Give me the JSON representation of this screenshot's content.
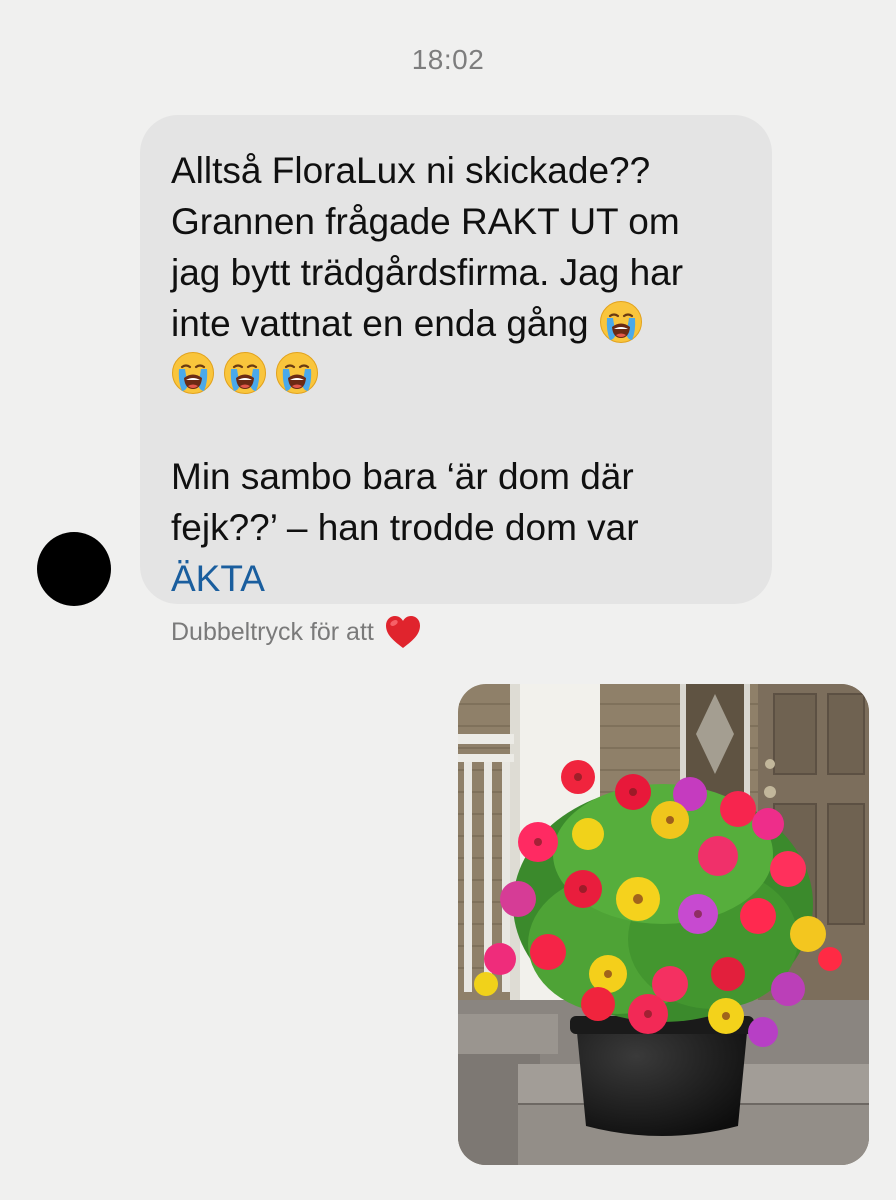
{
  "timestamp": "18:02",
  "message": {
    "lines": [
      "Alltså FloraLux ni skickade??",
      "Grannen frågade RAKT UT om",
      "jag bytt trädgårdsfirma. Jag har",
      "inte vattnat en enda gång"
    ],
    "para2_lines": [
      "Min sambo bara ‘är dom där",
      "fejk??’ – han trodde dom var"
    ],
    "link_text": "ÄKTA",
    "emoji_name": "loudly-crying-face",
    "emoji_count": 4
  },
  "reaction_hint": {
    "text": "Dubbeltryck för att",
    "icon": "red-heart-icon"
  },
  "colors": {
    "background": "#f0f0ef",
    "bubble": "#e4e4e4",
    "link": "#1a5e9e",
    "meta_text": "#7a7a7a"
  },
  "attachment": {
    "type": "photo",
    "subject": "flower-pot-on-porch"
  }
}
